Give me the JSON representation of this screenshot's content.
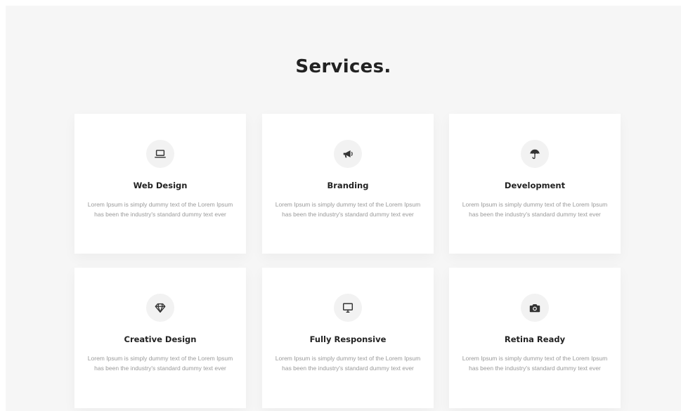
{
  "section": {
    "title": "Services."
  },
  "services": [
    {
      "name": "Web Design",
      "icon": "laptop-icon",
      "text": "Lorem Ipsum is simply dummy text of the Lorem Ipsum has been the industry's standard dummy text ever"
    },
    {
      "name": "Branding",
      "icon": "megaphone-icon",
      "text": "Lorem Ipsum is simply dummy text of the Lorem Ipsum has been the industry's standard dummy text ever"
    },
    {
      "name": "Development",
      "icon": "umbrella-icon",
      "text": "Lorem Ipsum is simply dummy text of the Lorem Ipsum has been the industry's standard dummy text ever"
    },
    {
      "name": "Creative Design",
      "icon": "diamond-icon",
      "text": "Lorem Ipsum is simply dummy text of the Lorem Ipsum has been the industry's standard dummy text ever"
    },
    {
      "name": "Fully Responsive",
      "icon": "monitor-icon",
      "text": "Lorem Ipsum is simply dummy text of the Lorem Ipsum has been the industry's standard dummy text ever"
    },
    {
      "name": "Retina Ready",
      "icon": "camera-icon",
      "text": "Lorem Ipsum is simply dummy text of the Lorem Ipsum has been the industry's standard dummy text ever"
    }
  ],
  "colors": {
    "background": "#f6f6f6",
    "card": "#ffffff",
    "heading": "#222222",
    "body_text": "#9a9a9a",
    "icon_circle": "#f2f2f2"
  }
}
